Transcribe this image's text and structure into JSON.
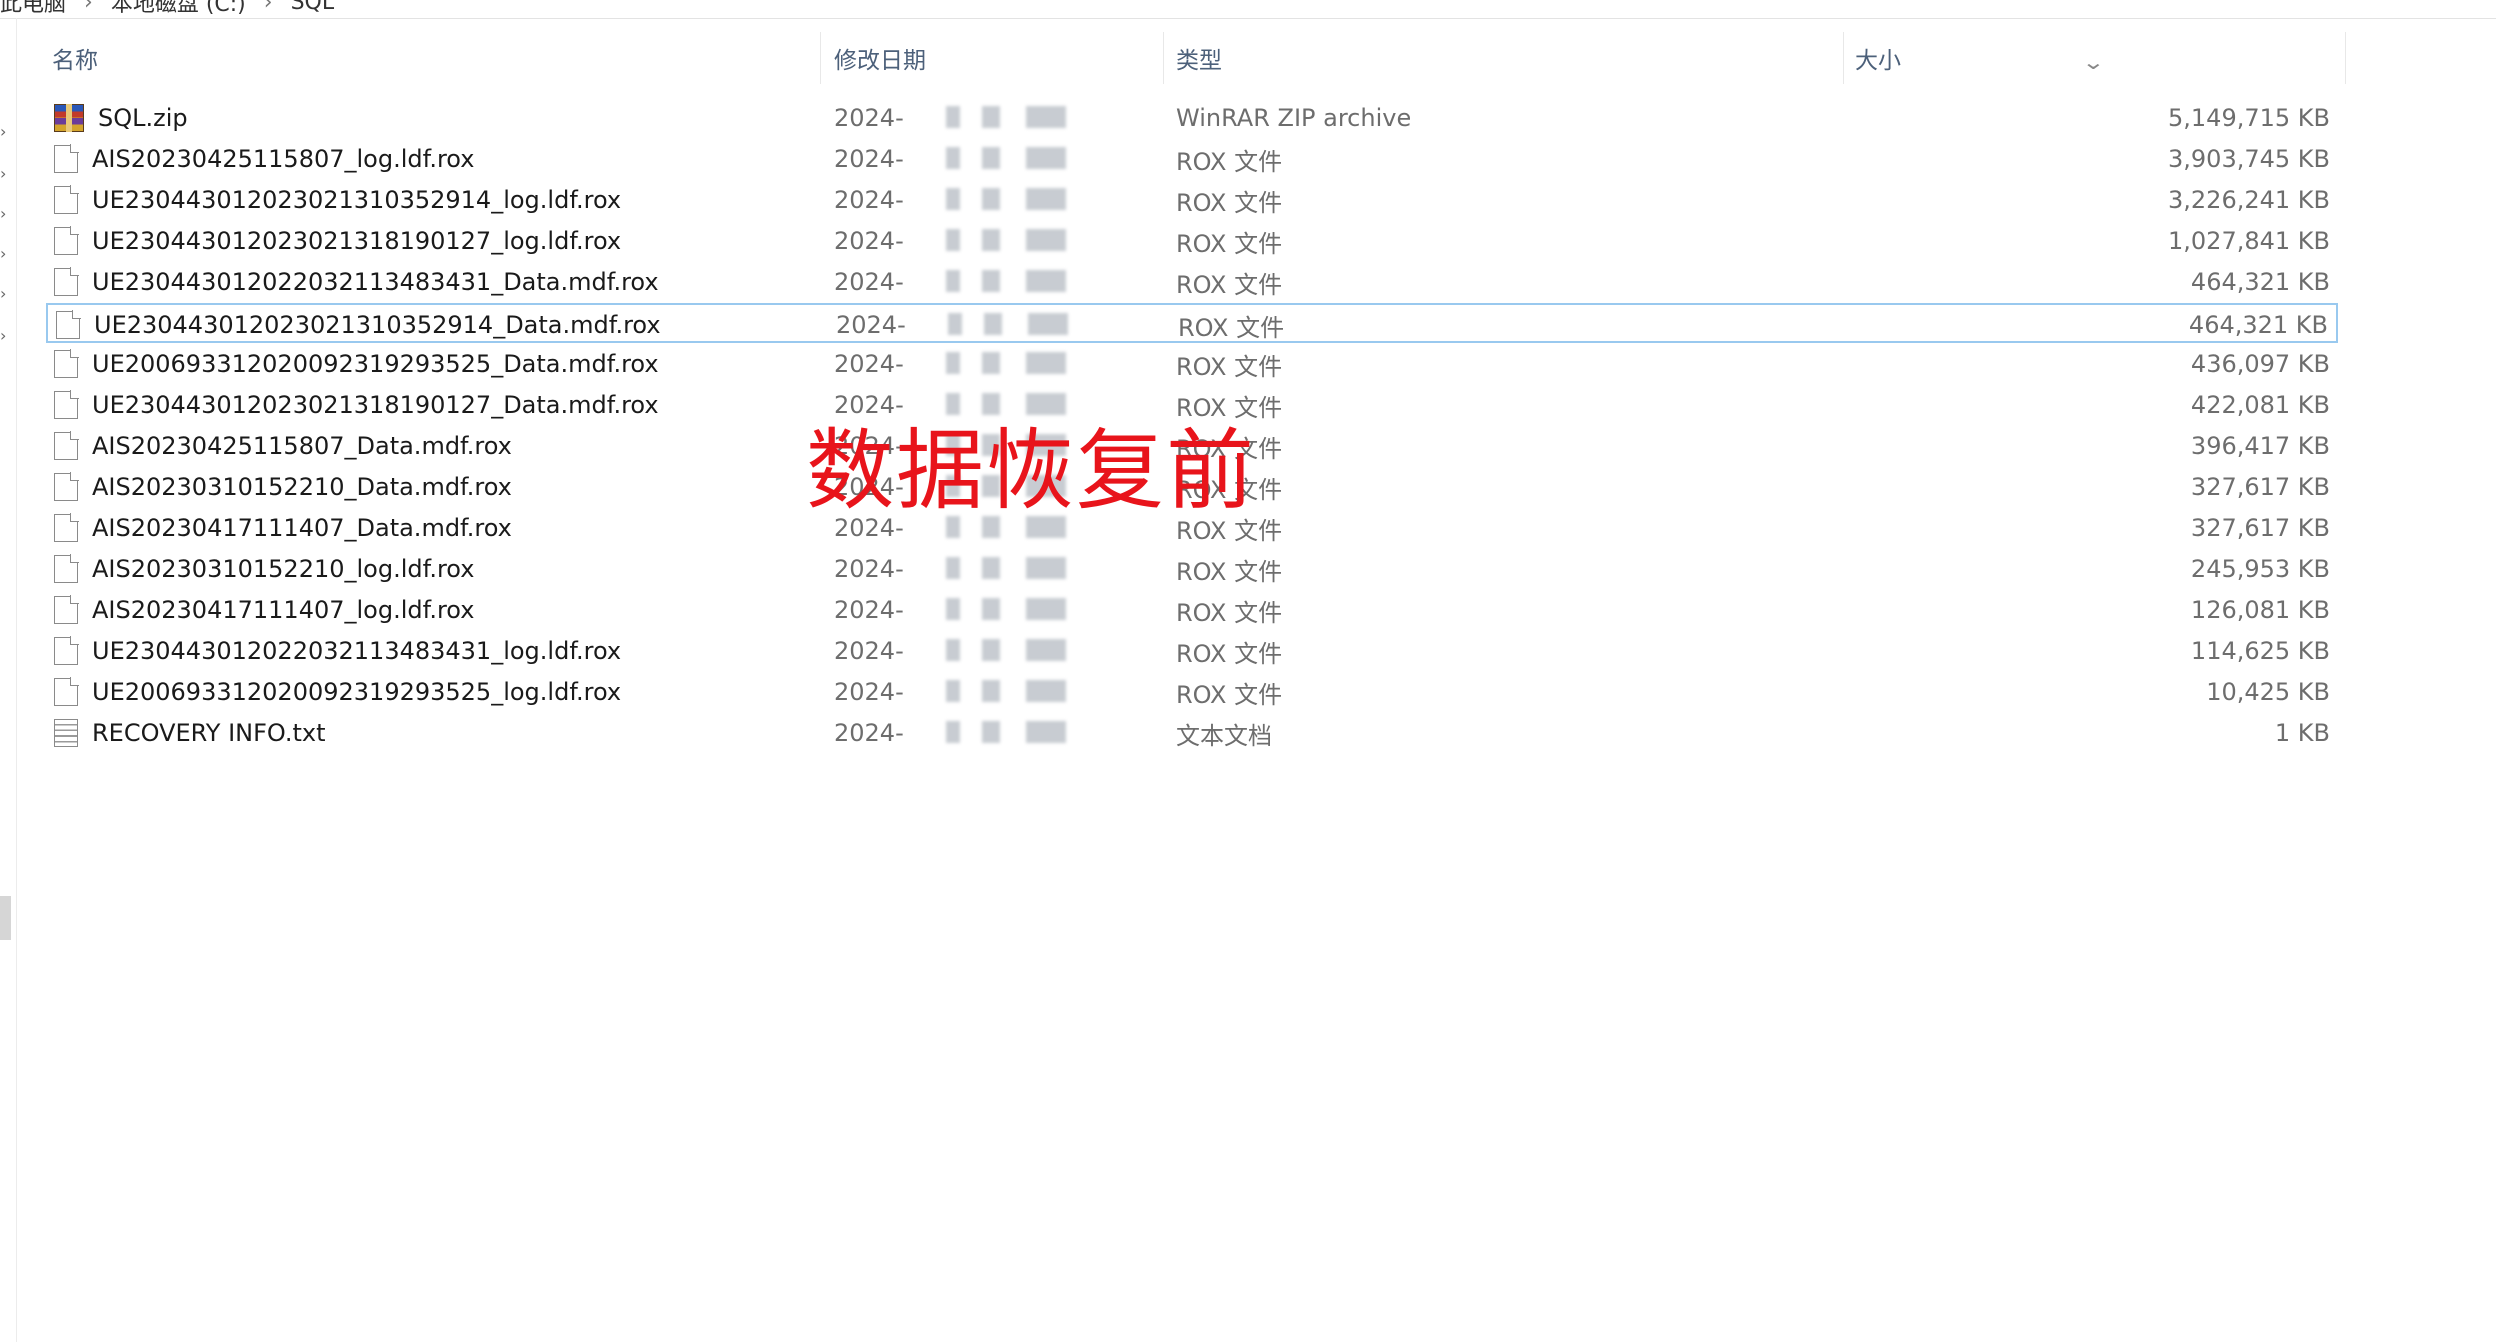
{
  "breadcrumb": [
    "此电脑",
    "本地磁盘 (C:)",
    "SQL"
  ],
  "columns": {
    "name": "名称",
    "date": "修改日期",
    "type": "类型",
    "size": "大小"
  },
  "selected_index": 5,
  "files": [
    {
      "name": "SQL.zip",
      "date": "2024-",
      "type": "WinRAR ZIP archive",
      "size": "5,149,715 KB",
      "icon": "zip-archive-icon"
    },
    {
      "name": "AIS20230425115807_log.ldf.rox",
      "date": "2024-",
      "type": "ROX 文件",
      "size": "3,903,745 KB",
      "icon": "file-icon"
    },
    {
      "name": "UE230443012023021310352914_log.ldf.rox",
      "date": "2024-",
      "type": "ROX 文件",
      "size": "3,226,241 KB",
      "icon": "file-icon"
    },
    {
      "name": "UE230443012023021318190127_log.ldf.rox",
      "date": "2024-",
      "type": "ROX 文件",
      "size": "1,027,841 KB",
      "icon": "file-icon"
    },
    {
      "name": "UE230443012022032113483431_Data.mdf.rox",
      "date": "2024-",
      "type": "ROX 文件",
      "size": "464,321 KB",
      "icon": "file-icon"
    },
    {
      "name": "UE230443012023021310352914_Data.mdf.rox",
      "date": "2024-",
      "type": "ROX 文件",
      "size": "464,321 KB",
      "icon": "file-icon"
    },
    {
      "name": "UE200693312020092319293525_Data.mdf.rox",
      "date": "2024-",
      "type": "ROX 文件",
      "size": "436,097 KB",
      "icon": "file-icon"
    },
    {
      "name": "UE230443012023021318190127_Data.mdf.rox",
      "date": "2024-",
      "type": "ROX 文件",
      "size": "422,081 KB",
      "icon": "file-icon"
    },
    {
      "name": "AIS20230425115807_Data.mdf.rox",
      "date": "2024-",
      "type": "ROX 文件",
      "size": "396,417 KB",
      "icon": "file-icon"
    },
    {
      "name": "AIS20230310152210_Data.mdf.rox",
      "date": "2024-",
      "type": "ROX 文件",
      "size": "327,617 KB",
      "icon": "file-icon"
    },
    {
      "name": "AIS20230417111407_Data.mdf.rox",
      "date": "2024-",
      "type": "ROX 文件",
      "size": "327,617 KB",
      "icon": "file-icon"
    },
    {
      "name": "AIS20230310152210_log.ldf.rox",
      "date": "2024-",
      "type": "ROX 文件",
      "size": "245,953 KB",
      "icon": "file-icon"
    },
    {
      "name": "AIS20230417111407_log.ldf.rox",
      "date": "2024-",
      "type": "ROX 文件",
      "size": "126,081 KB",
      "icon": "file-icon"
    },
    {
      "name": "UE230443012022032113483431_log.ldf.rox",
      "date": "2024-",
      "type": "ROX 文件",
      "size": "114,625 KB",
      "icon": "file-icon"
    },
    {
      "name": "UE200693312020092319293525_log.ldf.rox",
      "date": "2024-",
      "type": "ROX 文件",
      "size": "10,425 KB",
      "icon": "file-icon"
    },
    {
      "name": "RECOVERY INFO.txt",
      "date": "2024-",
      "type": "文本文档",
      "size": "1 KB",
      "icon": "text-file-icon"
    }
  ],
  "overlay_label": "数据恢复前",
  "colors": {
    "selection_border": "#99c9ef",
    "overlay_text": "#e8141b",
    "header_text": "#4c607a"
  }
}
